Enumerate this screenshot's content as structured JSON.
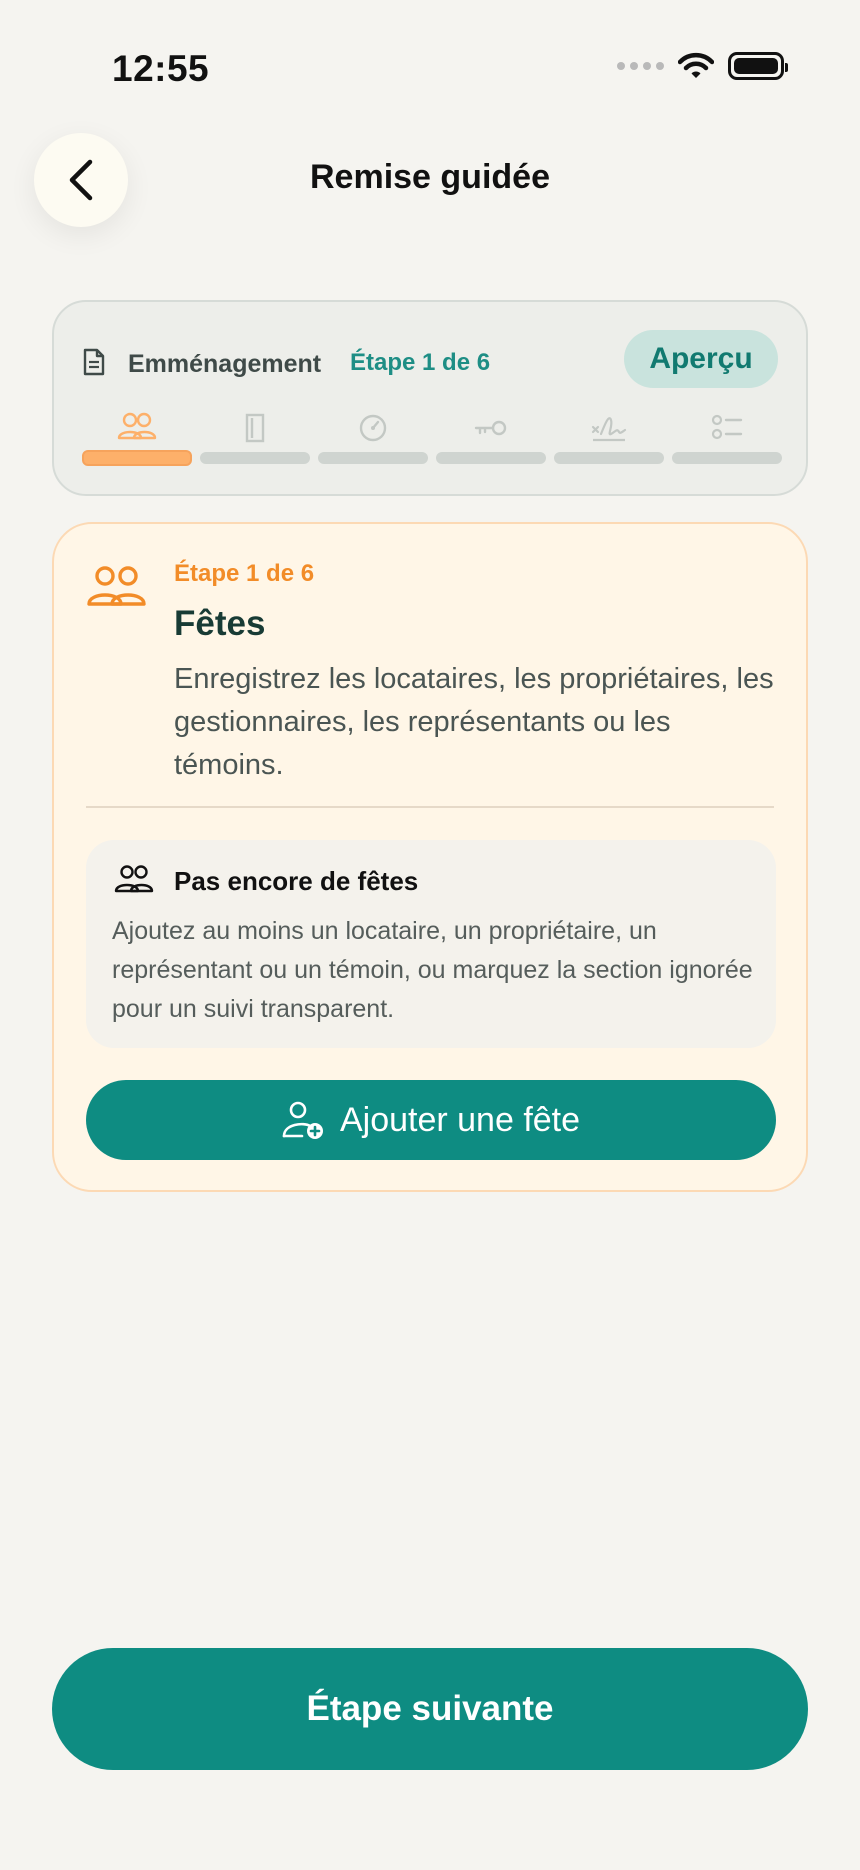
{
  "status_bar": {
    "time": "12:55"
  },
  "header": {
    "title": "Remise guidée",
    "back_icon": "chevron-left-icon"
  },
  "progress": {
    "flow_label": "Emménagement",
    "step_label": "Étape 1 de 6",
    "preview_label": "Aperçu",
    "steps": [
      {
        "icon": "people-icon",
        "active": true
      },
      {
        "icon": "door-icon",
        "active": false
      },
      {
        "icon": "meter-icon",
        "active": false
      },
      {
        "icon": "key-icon",
        "active": false
      },
      {
        "icon": "signature-icon",
        "active": false
      },
      {
        "icon": "checklist-icon",
        "active": false
      }
    ],
    "current_step": 1,
    "total_steps": 6
  },
  "step_card": {
    "step_label": "Étape 1 de 6",
    "title": "Fêtes",
    "description": "Enregistrez les locataires, les propriétaires, les gestionnaires, les représentants ou les témoins.",
    "empty_title": "Pas encore de fêtes",
    "empty_text": "Ajoutez au moins un locataire, un propriétaire, un représentant ou un témoin, ou marquez la section ignorée pour un suivi transparent.",
    "add_button_label": "Ajouter une fête"
  },
  "footer": {
    "next_label": "Étape suivante"
  },
  "colors": {
    "background": "#F5F4F0",
    "accent_teal": "#0E8C82",
    "accent_orange": "#F28C28",
    "card_cream": "#FFF6E7"
  }
}
